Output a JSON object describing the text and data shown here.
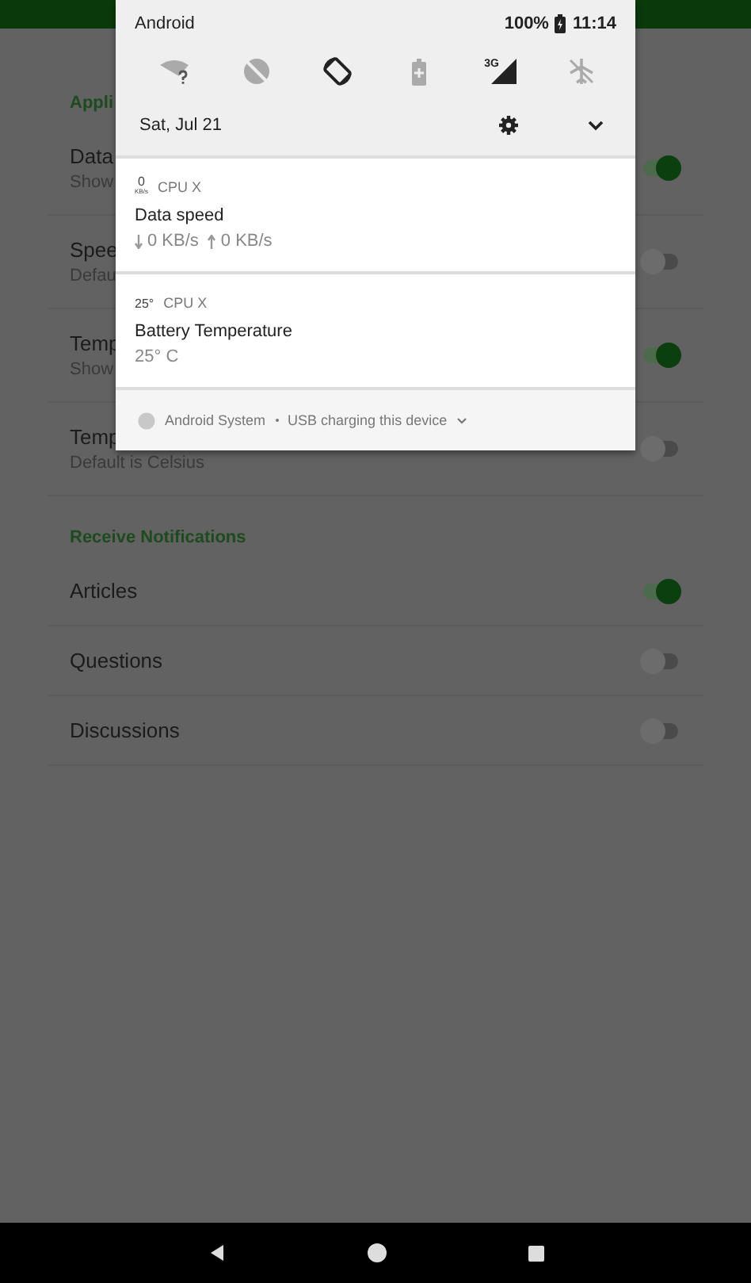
{
  "settings": {
    "sections": [
      {
        "header": "Appli",
        "rows": [
          {
            "title": "Data",
            "summary": "Show",
            "on": true
          },
          {
            "title": "Spee",
            "summary": "Defau",
            "on": false
          },
          {
            "title": "Temp",
            "summary": "Show",
            "on": true
          },
          {
            "title": "Temp",
            "summary": "Default is Celsius",
            "on": false
          }
        ]
      },
      {
        "header": "Receive Notifications",
        "rows": [
          {
            "title": "Articles",
            "on": true
          },
          {
            "title": "Questions",
            "on": false
          },
          {
            "title": "Discussions",
            "on": false
          }
        ]
      }
    ]
  },
  "shade": {
    "carrier": "Android",
    "battery": "100%",
    "time": "11:14",
    "date": "Sat, Jul 21",
    "tiles": [
      {
        "kind": "wifi",
        "on": false
      },
      {
        "kind": "dnd",
        "on": false
      },
      {
        "kind": "rotate",
        "on": true
      },
      {
        "kind": "saver",
        "on": false
      },
      {
        "kind": "cell",
        "label": "3G",
        "on": true
      },
      {
        "kind": "airplane",
        "on": false
      }
    ],
    "notifications": [
      {
        "kind": "speed",
        "icon_value": "0",
        "icon_unit": "KB/s",
        "app": "CPU X",
        "title": "Data speed",
        "down": "0 KB/s",
        "up": "0 KB/s"
      },
      {
        "kind": "temp",
        "icon_value": "25°",
        "app": "CPU X",
        "title": "Battery Temperature",
        "text": "25° C"
      }
    ],
    "footer": {
      "app": "Android System",
      "text": "USB charging this device"
    }
  }
}
